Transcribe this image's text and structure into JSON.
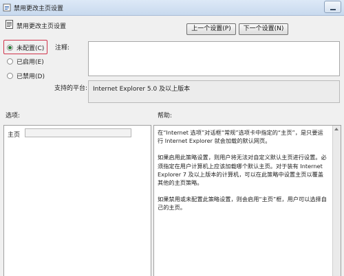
{
  "window": {
    "title": "禁用更改主页设置"
  },
  "header": {
    "policy_title": "禁用更改主页设置"
  },
  "nav": {
    "prev_label": "上一个设置(P)",
    "next_label": "下一个设置(N)"
  },
  "state": {
    "options": [
      {
        "label": "未配置(C)",
        "checked": true
      },
      {
        "label": "已启用(E)",
        "checked": false
      },
      {
        "label": "已禁用(D)",
        "checked": false
      }
    ]
  },
  "comment": {
    "label": "注释:",
    "value": ""
  },
  "platform": {
    "label": "支持的平台:",
    "value": "Internet Explorer 5.0 及以上版本"
  },
  "options_panel": {
    "label": "选项:",
    "home_label": "主页",
    "home_value": ""
  },
  "help_panel": {
    "label": "帮助:",
    "paragraphs": [
      "在“Internet 选项”对话框“常规”选项卡中指定的“主页”，是只要运行 Internet Explorer 就会加载的默认网页。",
      "如果启用此策略设置，则用户将无法对自定义默认主页进行设置。必须指定在用户计算机上应该加载哪个默认主页。对于装有 Internet Explorer 7 及以上版本的计算机，可以在此策略中设置主页以覆盖其他的主页策略。",
      "如果禁用或未配置此策略设置，则会启用“主页”框，用户可以选择自己的主页。"
    ]
  },
  "colors": {
    "focus": "#d0324a",
    "radio_dot": "#2c7a3a",
    "titlebar": "#c8d9ee"
  },
  "icons": {
    "title": "policy-setting-icon",
    "header": "policy-document-icon",
    "minimize": "minimize-icon"
  }
}
